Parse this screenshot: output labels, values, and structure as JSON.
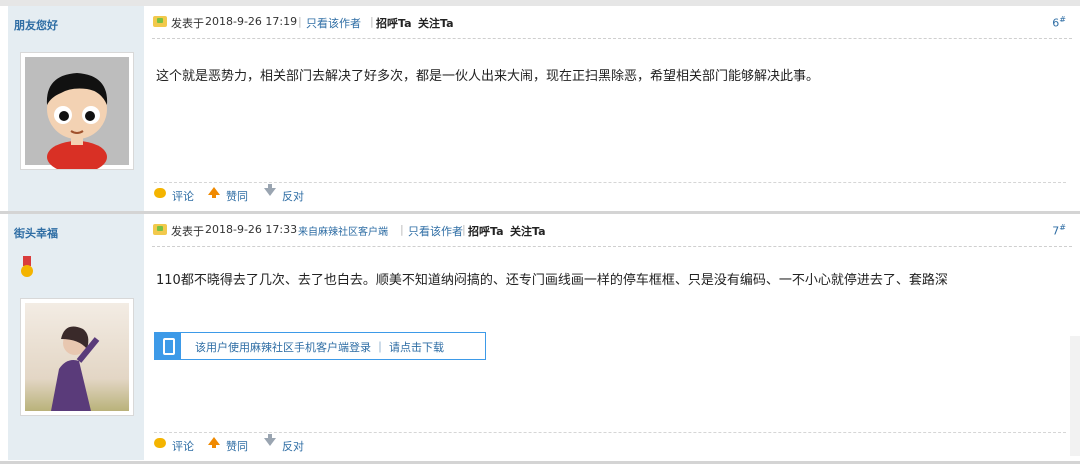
{
  "posts": [
    {
      "author": "朋友您好",
      "posted_prefix": "发表于",
      "datetime": "2018-9-26 17:19",
      "source": "",
      "only_author": "只看该作者",
      "greet": "招呼Ta",
      "follow": "关注Ta",
      "floor": "6",
      "content": "这个就是恶势力，相关部门去解决了好多次，都是一伙人出来大闹，现在正扫黑除恶，希望相关部门能够解决此事。",
      "actions": {
        "comment": "评论",
        "agree": "赞同",
        "oppose": "反对"
      },
      "avatar_icon": "cartoon-boy-avatar"
    },
    {
      "author": "街头幸福",
      "posted_prefix": "发表于",
      "datetime": "2018-9-26 17:33",
      "source": "来自麻辣社区客户端",
      "only_author": "只看该作者",
      "greet": "招呼Ta",
      "follow": "关注Ta",
      "floor": "7",
      "content": "110都不晓得去了几次、去了也白去。顺美不知道纳闷搞的、还专门画线画一样的停车框框、只是没有编码、一不小心就停进去了、套路深",
      "app_banner": "该用户使用麻辣社区手机客户端登录 ｜ 请点击下载",
      "actions": {
        "comment": "评论",
        "agree": "赞同",
        "oppose": "反对"
      },
      "avatar_icon": "photo-girl-avatar"
    }
  ],
  "colors": {
    "link": "#2e6da4",
    "sidebar": "#e5edf2",
    "accent": "#3d9ae8"
  }
}
